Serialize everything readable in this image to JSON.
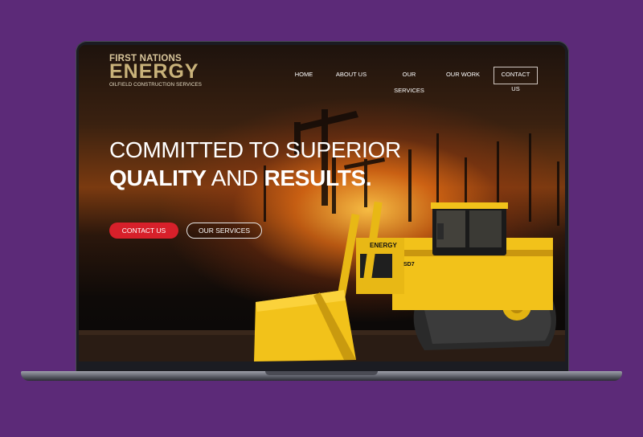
{
  "site": {
    "logo": {
      "line1": "FIRST NATIONS",
      "line2": "ENERGY",
      "tagline": "OILFIELD CONSTRUCTION SERVICES"
    },
    "nav": {
      "items": [
        {
          "label": "HOME"
        },
        {
          "label": "ABOUT US"
        },
        {
          "label": "OUR SERVICES"
        },
        {
          "label": "OUR WORK"
        },
        {
          "label": "CONTACT US"
        }
      ]
    },
    "hero": {
      "line1": "COMMITTED TO SUPERIOR",
      "line2_bold_a": "QUALITY",
      "line2_mid": " AND ",
      "line2_bold_b": "RESULTS.",
      "primary_button": "CONTACT US",
      "secondary_button": "OUR SERVICES"
    },
    "image": {
      "bulldozer_model": "SD7",
      "bulldozer_brand": "ENERGY"
    }
  },
  "colors": {
    "background": "#5c2a78",
    "accent_red": "#d7202a",
    "logo_gold": "#c9b27a",
    "machine_yellow": "#f2c21a"
  }
}
